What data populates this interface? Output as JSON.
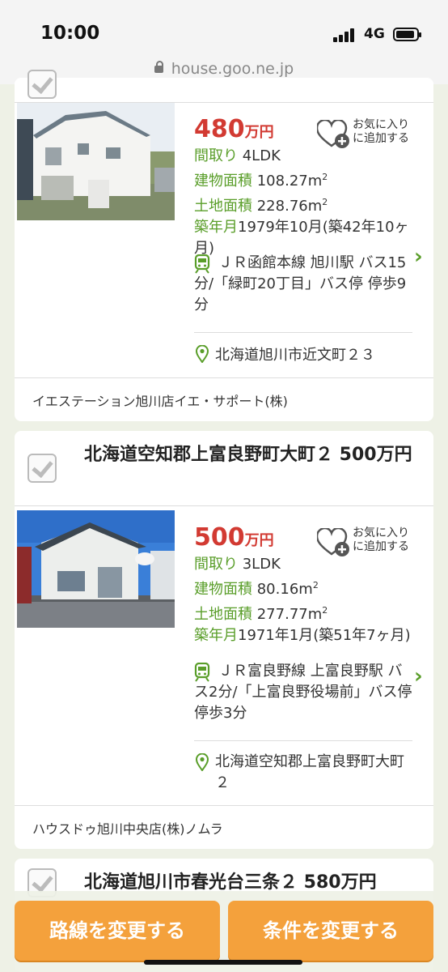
{
  "status": {
    "time": "10:00",
    "network": "4G"
  },
  "browser": {
    "url": "house.goo.ne.jp"
  },
  "listings": [
    {
      "price": "480",
      "price_unit": "万円",
      "favorite": {
        "line1": "お気に入り",
        "line2": "に追加する"
      },
      "layout_label": "間取り",
      "layout": "4LDK",
      "building_label": "建物面積",
      "building": "108.27m",
      "land_label": "土地面積",
      "land": "228.76m",
      "built_label": "築年月",
      "built": "1979年10月(築42年10ヶ月)",
      "access": "ＪＲ函館本線 旭川駅 バス15分/「緑町20丁目」バス停 停歩9分",
      "address": "北海道旭川市近文町２３",
      "agency": "イエステーション旭川店イエ・サポート(株)"
    },
    {
      "title": "北海道空知郡上富良野町大町２ 500万円",
      "price": "500",
      "price_unit": "万円",
      "favorite": {
        "line1": "お気に入り",
        "line2": "に追加する"
      },
      "layout_label": "間取り",
      "layout": "3LDK",
      "building_label": "建物面積",
      "building": "80.16m",
      "land_label": "土地面積",
      "land": "277.77m",
      "built_label": "築年月",
      "built": "1971年1月(築51年7ヶ月)",
      "access": "ＪＲ富良野線 上富良野駅 バス2分/「上富良野役場前」バス停 停歩3分",
      "address": "北海道空知郡上富良野町大町２",
      "agency": "ハウスドゥ旭川中央店(株)ノムラ"
    },
    {
      "title": "北海道旭川市春光台三条２ 580万円"
    }
  ],
  "buttons": {
    "route": "路線を変更する",
    "conditions": "条件を変更する"
  },
  "colors": {
    "accent_green": "#5a9e2a",
    "price_red": "#d23a32",
    "button_orange": "#f4a13c"
  }
}
